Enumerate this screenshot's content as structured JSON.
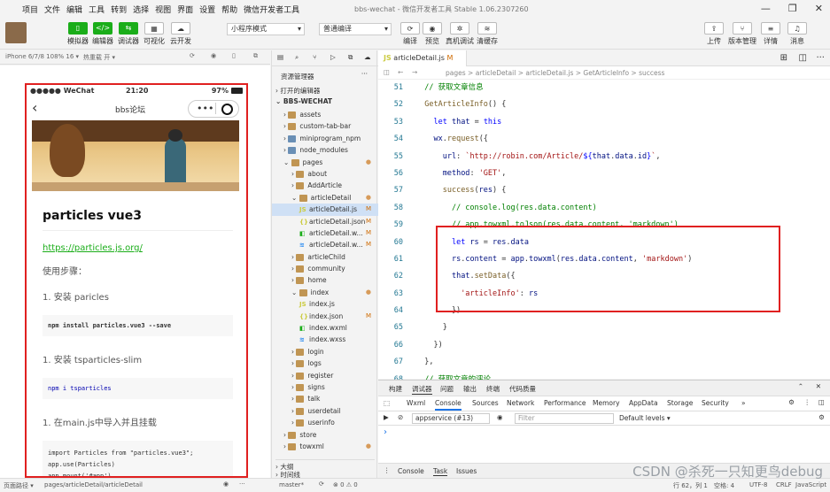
{
  "menubar": {
    "items": [
      "项目",
      "文件",
      "编辑",
      "工具",
      "转到",
      "选择",
      "视图",
      "界面",
      "设置",
      "帮助",
      "微信开发者工具"
    ],
    "window_title": "bbs-wechat - 微信开发者工具 Stable 1.06.2307260"
  },
  "toolbar": {
    "simulator": "模拟器",
    "editor": "编辑器",
    "debugger": "调试器",
    "visual": "可视化",
    "cloud": "云开发",
    "mode": "小程序模式",
    "compile_mode": "普通编译",
    "compile": "编译",
    "preview": "预览",
    "real_debug": "真机调试",
    "clear_cache": "清缓存",
    "upload": "上传",
    "version": "版本管理",
    "details": "详情",
    "messages": "消息"
  },
  "simulator": {
    "device": "iPhone 6/7/8 108% 16 ▾",
    "hotreload": "热重载 开 ▾",
    "status_left": "●●●●● WeChat",
    "time": "21:20",
    "battery": "97%",
    "nav_title": "bbs论坛",
    "article_title": "particles vue3",
    "link": "https://particles.js.org/",
    "steps": "使用步骤：",
    "step1": "1. 安装 paricles",
    "code1": "npm install particles.vue3 --save",
    "step2": "1. 安装 tsparticles-slim",
    "code2": "npm i tsparticles",
    "step3": "1. 在main.js中导入并且挂载",
    "code3a": "import Particles from \"particles.vue3\";",
    "code3b": "app.use(Particles)",
    "code3c": "app.mount('#app')"
  },
  "explorer": {
    "title": "资源管理器",
    "open_editors": "打开的编辑器",
    "project": "BBS-WECHAT",
    "outline": "大纲",
    "timeline": "时间线",
    "items": [
      {
        "name": "assets",
        "type": "folder",
        "depth": 1,
        "badge": ""
      },
      {
        "name": "custom-tab-bar",
        "type": "folder",
        "depth": 1,
        "badge": ""
      },
      {
        "name": "miniprogram_npm",
        "type": "folder",
        "depth": 1,
        "badge": ""
      },
      {
        "name": "node_modules",
        "type": "folder",
        "depth": 1,
        "badge": ""
      },
      {
        "name": "pages",
        "type": "folder",
        "depth": 1,
        "badge": "●"
      },
      {
        "name": "about",
        "type": "folder",
        "depth": 2,
        "badge": ""
      },
      {
        "name": "AddArticle",
        "type": "folder",
        "depth": 2,
        "badge": ""
      },
      {
        "name": "articleDetail",
        "type": "folder",
        "depth": 2,
        "badge": "●"
      },
      {
        "name": "articleDetail.js",
        "type": "js",
        "depth": 3,
        "badge": "M"
      },
      {
        "name": "articleDetail.json",
        "type": "json",
        "depth": 3,
        "badge": "M"
      },
      {
        "name": "articleDetail.w...",
        "type": "wxml",
        "depth": 3,
        "badge": "M"
      },
      {
        "name": "articleDetail.w...",
        "type": "wxss",
        "depth": 3,
        "badge": "M"
      },
      {
        "name": "articleChild",
        "type": "folder",
        "depth": 2,
        "badge": ""
      },
      {
        "name": "community",
        "type": "folder",
        "depth": 2,
        "badge": ""
      },
      {
        "name": "home",
        "type": "folder",
        "depth": 2,
        "badge": ""
      },
      {
        "name": "index",
        "type": "folder",
        "depth": 2,
        "badge": "●"
      },
      {
        "name": "index.js",
        "type": "js",
        "depth": 3,
        "badge": ""
      },
      {
        "name": "index.json",
        "type": "json",
        "depth": 3,
        "badge": "M"
      },
      {
        "name": "index.wxml",
        "type": "wxml",
        "depth": 3,
        "badge": ""
      },
      {
        "name": "index.wxss",
        "type": "wxss",
        "depth": 3,
        "badge": ""
      },
      {
        "name": "login",
        "type": "folder",
        "depth": 2,
        "badge": ""
      },
      {
        "name": "logs",
        "type": "folder",
        "depth": 2,
        "badge": ""
      },
      {
        "name": "register",
        "type": "folder",
        "depth": 2,
        "badge": ""
      },
      {
        "name": "signs",
        "type": "folder",
        "depth": 2,
        "badge": ""
      },
      {
        "name": "talk",
        "type": "folder",
        "depth": 2,
        "badge": ""
      },
      {
        "name": "userdetail",
        "type": "folder",
        "depth": 2,
        "badge": ""
      },
      {
        "name": "userinfo",
        "type": "folder",
        "depth": 2,
        "badge": ""
      },
      {
        "name": "store",
        "type": "folder",
        "depth": 1,
        "badge": ""
      },
      {
        "name": "towxml",
        "type": "folder",
        "depth": 1,
        "badge": "●"
      }
    ]
  },
  "editor": {
    "tab": "articleDetail.js",
    "tab_badge": "M",
    "breadcrumb": "pages > articleDetail > articleDetail.js > GetArticleInfo > success",
    "lines": [
      {
        "n": "51",
        "html": "  <span class='cm'>// 获取文章信息</span>"
      },
      {
        "n": "52",
        "html": "  <span class='fn'>GetArticleInfo</span>() {"
      },
      {
        "n": "53",
        "html": "    <span class='kw'>let</span> <span class='var'>that</span> = <span class='kw'>this</span>"
      },
      {
        "n": "54",
        "html": "    <span class='var'>wx</span>.<span class='fn'>request</span>({"
      },
      {
        "n": "55",
        "html": "      <span class='var'>url</span>: <span class='str'>`http://robin.com/Article/</span><span class='kw'>${</span><span class='var'>that</span>.<span class='var'>data</span>.<span class='var'>id</span><span class='kw'>}</span><span class='str'>`</span>,"
      },
      {
        "n": "56",
        "html": "      <span class='var'>method</span>: <span class='str'>'GET'</span>,"
      },
      {
        "n": "57",
        "html": "      <span class='fn'>success</span>(<span class='var'>res</span>) {"
      },
      {
        "n": "58",
        "html": "        <span class='cm'>// console.log(res.data.content)</span>"
      },
      {
        "n": "59",
        "html": "        <span class='cm'>// app.towxml.toJson(res.data.content, 'markdown')</span>"
      },
      {
        "n": "60",
        "html": "        <span class='kw'>let</span> <span class='var'>rs</span> = <span class='var'>res</span>.<span class='var'>data</span>"
      },
      {
        "n": "61",
        "html": "        <span class='var'>rs</span>.<span class='var'>content</span> = <span class='var'>app</span>.<span class='var'>towxml</span>(<span class='var'>res</span>.<span class='var'>data</span>.<span class='var'>content</span>, <span class='str'>'markdown'</span>)"
      },
      {
        "n": "62",
        "html": "        <span class='var'>that</span>.<span class='fn'>setData</span>({"
      },
      {
        "n": "63",
        "html": "          <span class='str'>'articleInfo'</span>: <span class='var'>rs</span>"
      },
      {
        "n": "64",
        "html": "        })"
      },
      {
        "n": "65",
        "html": "      }"
      },
      {
        "n": "66",
        "html": "    })"
      },
      {
        "n": "67",
        "html": "  },"
      },
      {
        "n": "68",
        "html": "  <span class='cm'>// 获取文章的评论</span>"
      }
    ]
  },
  "devtools": {
    "top_tabs": [
      "构建",
      "调试器",
      "问题",
      "输出",
      "终端",
      "代码质量"
    ],
    "active_top": "调试器",
    "panel_tabs": [
      "Wxml",
      "Console",
      "Sources",
      "Network",
      "Performance",
      "Memory",
      "AppData",
      "Storage",
      "Security",
      "»"
    ],
    "active_panel": "Console",
    "context": "appservice (#13)",
    "filter_placeholder": "Filter",
    "levels": "Default levels ▾",
    "prompt": "›",
    "bottom_tabs": [
      "Console",
      "Task",
      "Issues"
    ],
    "active_bottom": "Task"
  },
  "statusbar": {
    "path_label": "页面路径 ▾",
    "path": "pages/articleDetail/articleDetail",
    "branch": "master*",
    "errors": "⊗ 0 ⚠ 0",
    "cursor": "行 62，列 1",
    "spaces": "空格: 4",
    "encoding": "UTF-8",
    "eol": "CRLF",
    "lang": "JavaScript"
  },
  "watermark": "CSDN @杀死一只知更鸟debug",
  "colors": {
    "highlight_box": "#e02020",
    "accent_green": "#1aad19",
    "link": "#1aad19"
  }
}
